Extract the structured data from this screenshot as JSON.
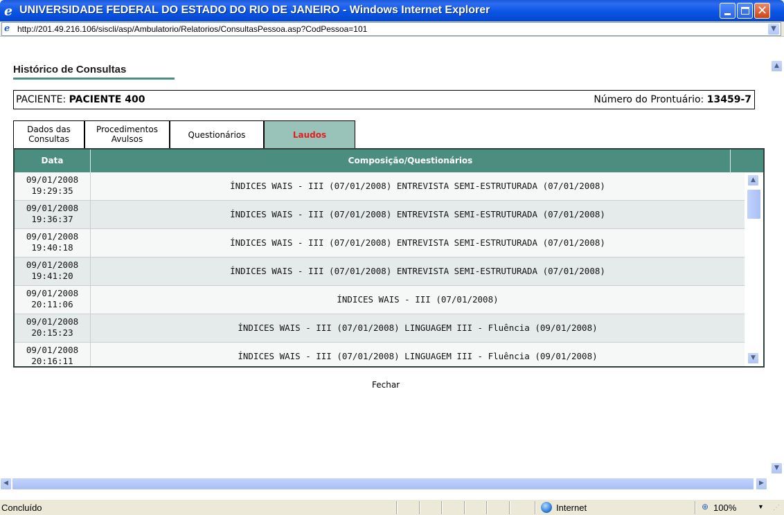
{
  "window": {
    "title": "UNIVERSIDADE FEDERAL DO ESTADO DO RIO DE JANEIRO - Windows Internet Explorer",
    "close_glyph": "✕"
  },
  "address": {
    "url": "http://201.49.216.106/siscli/asp/Ambulatorio/Relatorios/ConsultasPessoa.asp?CodPessoa=101"
  },
  "page": {
    "title": "Histórico de Consultas",
    "patient_label": "PACIENTE:",
    "patient_name": "PACIENTE 400",
    "record_label": "Número do Prontuário:",
    "record_number": "13459-7",
    "close_link": "Fechar"
  },
  "tabs": [
    {
      "line1": "Dados das",
      "line2": "Consultas"
    },
    {
      "line1": "Procedimentos",
      "line2": "Avulsos"
    },
    {
      "line1": "Questionários",
      "line2": ""
    },
    {
      "line1": "Laudos",
      "line2": ""
    }
  ],
  "table": {
    "col_date": "Data",
    "col_comp": "Composição/Questionários",
    "rows": [
      {
        "date": "09/01/2008",
        "time": "19:29:35",
        "comp": "ÍNDICES WAIS - III (07/01/2008) ENTREVISTA SEMI-ESTRUTURADA (07/01/2008)"
      },
      {
        "date": "09/01/2008",
        "time": "19:36:37",
        "comp": "ÍNDICES WAIS - III (07/01/2008) ENTREVISTA SEMI-ESTRUTURADA (07/01/2008)"
      },
      {
        "date": "09/01/2008",
        "time": "19:40:18",
        "comp": "ÍNDICES WAIS - III (07/01/2008) ENTREVISTA SEMI-ESTRUTURADA (07/01/2008)"
      },
      {
        "date": "09/01/2008",
        "time": "19:41:20",
        "comp": "ÍNDICES WAIS - III (07/01/2008) ENTREVISTA SEMI-ESTRUTURADA (07/01/2008)"
      },
      {
        "date": "09/01/2008",
        "time": "20:11:06",
        "comp": "ÍNDICES WAIS - III (07/01/2008)"
      },
      {
        "date": "09/01/2008",
        "time": "20:15:23",
        "comp": "ÍNDICES WAIS - III (07/01/2008) LINGUAGEM III - Fluência (09/01/2008)"
      },
      {
        "date": "09/01/2008",
        "time": "20:16:11",
        "comp": "ÍNDICES WAIS - III (07/01/2008) LINGUAGEM III - Fluência (09/01/2008)"
      }
    ]
  },
  "status": {
    "text": "Concluído",
    "zone": "Internet",
    "zoom": "100%"
  },
  "colors": {
    "header_green": "#4b8e80",
    "active_tab": "#99c3b8",
    "active_tab_text": "#e02020",
    "titlebar_blue": "#0a55e4"
  }
}
